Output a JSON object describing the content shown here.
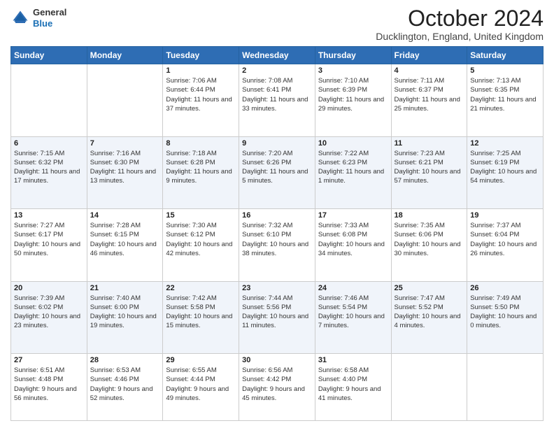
{
  "header": {
    "logo_line1": "General",
    "logo_line2": "Blue",
    "month": "October 2024",
    "location": "Ducklington, England, United Kingdom"
  },
  "days_of_week": [
    "Sunday",
    "Monday",
    "Tuesday",
    "Wednesday",
    "Thursday",
    "Friday",
    "Saturday"
  ],
  "weeks": [
    [
      {
        "day": "",
        "info": ""
      },
      {
        "day": "",
        "info": ""
      },
      {
        "day": "1",
        "info": "Sunrise: 7:06 AM\nSunset: 6:44 PM\nDaylight: 11 hours and 37 minutes."
      },
      {
        "day": "2",
        "info": "Sunrise: 7:08 AM\nSunset: 6:41 PM\nDaylight: 11 hours and 33 minutes."
      },
      {
        "day": "3",
        "info": "Sunrise: 7:10 AM\nSunset: 6:39 PM\nDaylight: 11 hours and 29 minutes."
      },
      {
        "day": "4",
        "info": "Sunrise: 7:11 AM\nSunset: 6:37 PM\nDaylight: 11 hours and 25 minutes."
      },
      {
        "day": "5",
        "info": "Sunrise: 7:13 AM\nSunset: 6:35 PM\nDaylight: 11 hours and 21 minutes."
      }
    ],
    [
      {
        "day": "6",
        "info": "Sunrise: 7:15 AM\nSunset: 6:32 PM\nDaylight: 11 hours and 17 minutes."
      },
      {
        "day": "7",
        "info": "Sunrise: 7:16 AM\nSunset: 6:30 PM\nDaylight: 11 hours and 13 minutes."
      },
      {
        "day": "8",
        "info": "Sunrise: 7:18 AM\nSunset: 6:28 PM\nDaylight: 11 hours and 9 minutes."
      },
      {
        "day": "9",
        "info": "Sunrise: 7:20 AM\nSunset: 6:26 PM\nDaylight: 11 hours and 5 minutes."
      },
      {
        "day": "10",
        "info": "Sunrise: 7:22 AM\nSunset: 6:23 PM\nDaylight: 11 hours and 1 minute."
      },
      {
        "day": "11",
        "info": "Sunrise: 7:23 AM\nSunset: 6:21 PM\nDaylight: 10 hours and 57 minutes."
      },
      {
        "day": "12",
        "info": "Sunrise: 7:25 AM\nSunset: 6:19 PM\nDaylight: 10 hours and 54 minutes."
      }
    ],
    [
      {
        "day": "13",
        "info": "Sunrise: 7:27 AM\nSunset: 6:17 PM\nDaylight: 10 hours and 50 minutes."
      },
      {
        "day": "14",
        "info": "Sunrise: 7:28 AM\nSunset: 6:15 PM\nDaylight: 10 hours and 46 minutes."
      },
      {
        "day": "15",
        "info": "Sunrise: 7:30 AM\nSunset: 6:12 PM\nDaylight: 10 hours and 42 minutes."
      },
      {
        "day": "16",
        "info": "Sunrise: 7:32 AM\nSunset: 6:10 PM\nDaylight: 10 hours and 38 minutes."
      },
      {
        "day": "17",
        "info": "Sunrise: 7:33 AM\nSunset: 6:08 PM\nDaylight: 10 hours and 34 minutes."
      },
      {
        "day": "18",
        "info": "Sunrise: 7:35 AM\nSunset: 6:06 PM\nDaylight: 10 hours and 30 minutes."
      },
      {
        "day": "19",
        "info": "Sunrise: 7:37 AM\nSunset: 6:04 PM\nDaylight: 10 hours and 26 minutes."
      }
    ],
    [
      {
        "day": "20",
        "info": "Sunrise: 7:39 AM\nSunset: 6:02 PM\nDaylight: 10 hours and 23 minutes."
      },
      {
        "day": "21",
        "info": "Sunrise: 7:40 AM\nSunset: 6:00 PM\nDaylight: 10 hours and 19 minutes."
      },
      {
        "day": "22",
        "info": "Sunrise: 7:42 AM\nSunset: 5:58 PM\nDaylight: 10 hours and 15 minutes."
      },
      {
        "day": "23",
        "info": "Sunrise: 7:44 AM\nSunset: 5:56 PM\nDaylight: 10 hours and 11 minutes."
      },
      {
        "day": "24",
        "info": "Sunrise: 7:46 AM\nSunset: 5:54 PM\nDaylight: 10 hours and 7 minutes."
      },
      {
        "day": "25",
        "info": "Sunrise: 7:47 AM\nSunset: 5:52 PM\nDaylight: 10 hours and 4 minutes."
      },
      {
        "day": "26",
        "info": "Sunrise: 7:49 AM\nSunset: 5:50 PM\nDaylight: 10 hours and 0 minutes."
      }
    ],
    [
      {
        "day": "27",
        "info": "Sunrise: 6:51 AM\nSunset: 4:48 PM\nDaylight: 9 hours and 56 minutes."
      },
      {
        "day": "28",
        "info": "Sunrise: 6:53 AM\nSunset: 4:46 PM\nDaylight: 9 hours and 52 minutes."
      },
      {
        "day": "29",
        "info": "Sunrise: 6:55 AM\nSunset: 4:44 PM\nDaylight: 9 hours and 49 minutes."
      },
      {
        "day": "30",
        "info": "Sunrise: 6:56 AM\nSunset: 4:42 PM\nDaylight: 9 hours and 45 minutes."
      },
      {
        "day": "31",
        "info": "Sunrise: 6:58 AM\nSunset: 4:40 PM\nDaylight: 9 hours and 41 minutes."
      },
      {
        "day": "",
        "info": ""
      },
      {
        "day": "",
        "info": ""
      }
    ]
  ]
}
